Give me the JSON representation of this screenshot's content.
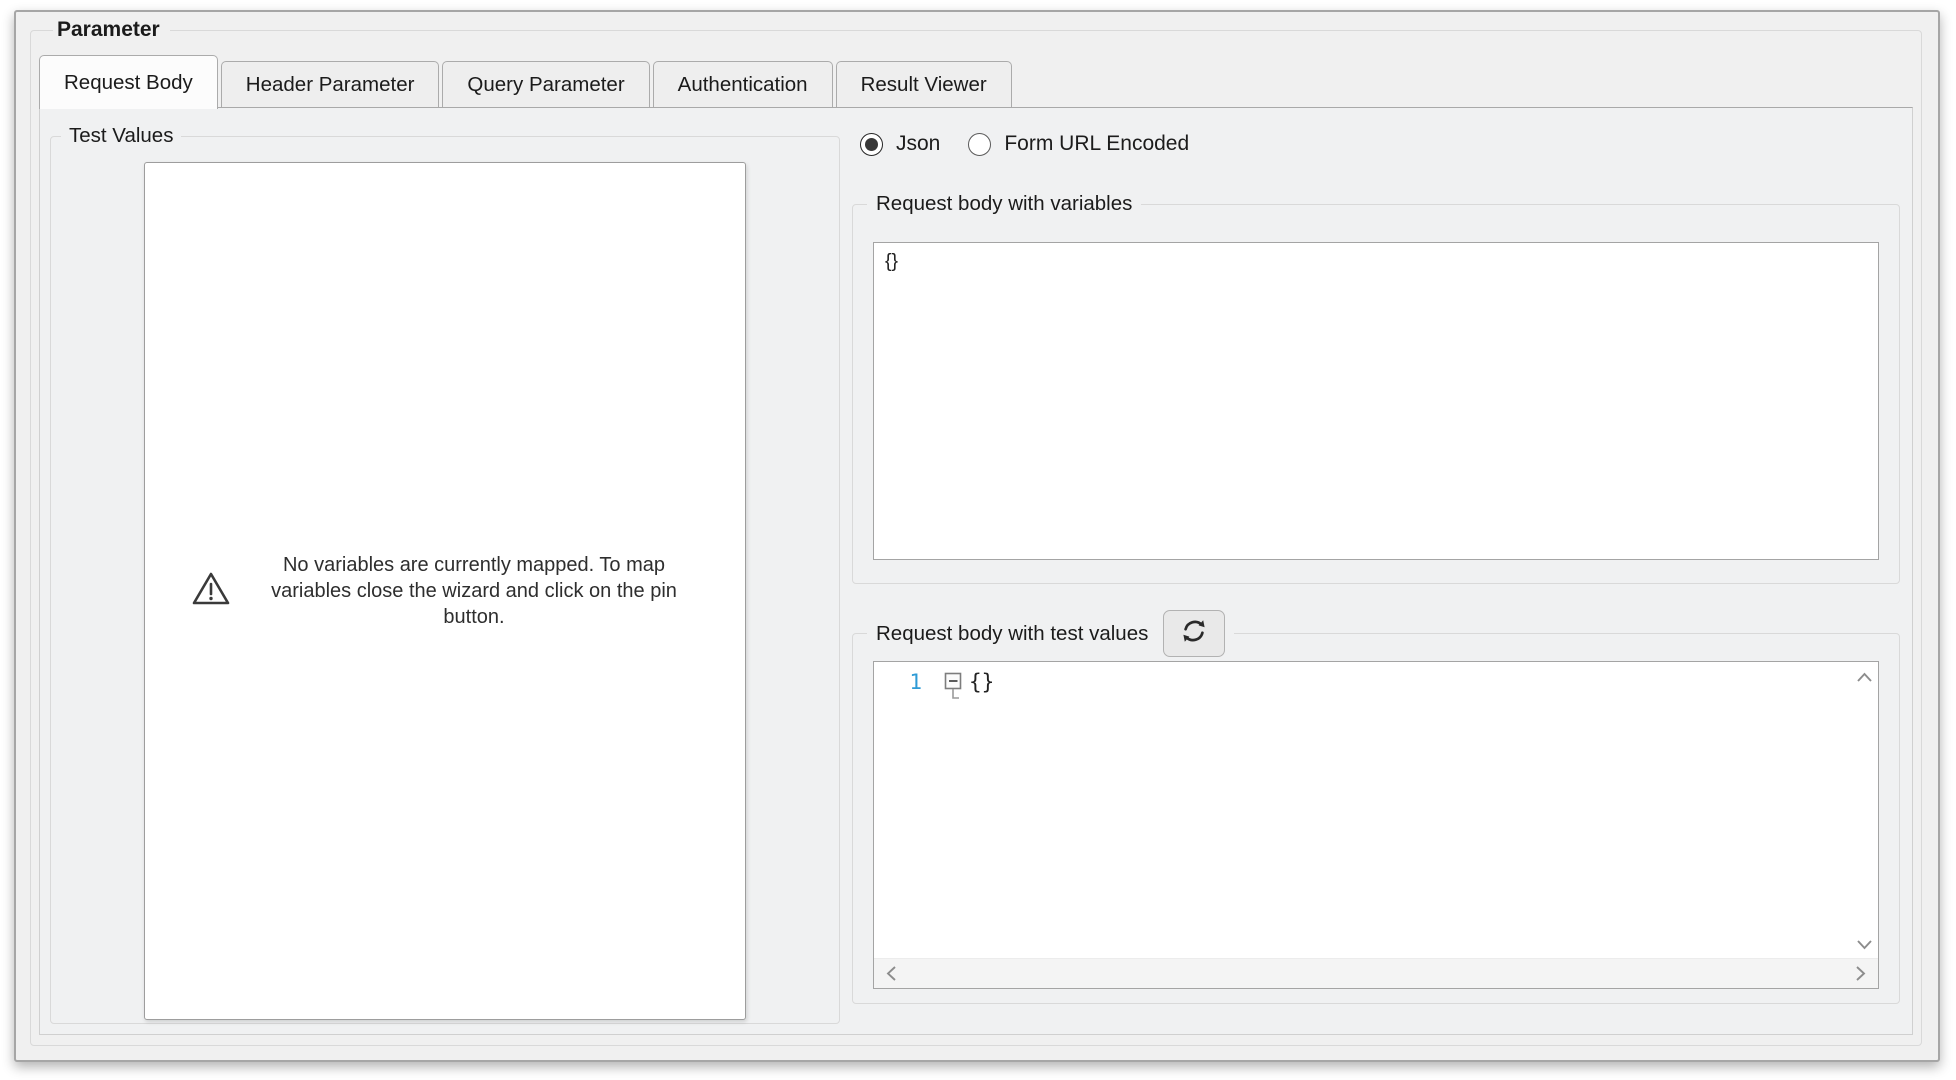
{
  "window": {
    "group_title": "Parameter"
  },
  "tabs": [
    {
      "label": "Request Body",
      "active": true
    },
    {
      "label": "Header Parameter",
      "active": false
    },
    {
      "label": "Query Parameter",
      "active": false
    },
    {
      "label": "Authentication",
      "active": false
    },
    {
      "label": "Result Viewer",
      "active": false
    }
  ],
  "left_panel": {
    "title": "Test Values",
    "warning_icon": "warning-triangle-icon",
    "empty_message": "No variables are currently mapped. To map variables close the wizard and click on the pin button."
  },
  "body_format": {
    "options": [
      {
        "label": "Json",
        "selected": true
      },
      {
        "label": "Form URL Encoded",
        "selected": false
      }
    ]
  },
  "request_body_variables": {
    "title": "Request body with variables",
    "value": "{}"
  },
  "request_body_test_values": {
    "title": "Request body with test values",
    "refresh_icon": "sync-refresh-icon",
    "editor": {
      "line_number": "1",
      "fold_icon": "collapse-region-icon",
      "code": "{}"
    }
  },
  "colors": {
    "line_number_blue": "#2e9bd6",
    "background": "#f0f0f0",
    "panel_white": "#ffffff"
  }
}
